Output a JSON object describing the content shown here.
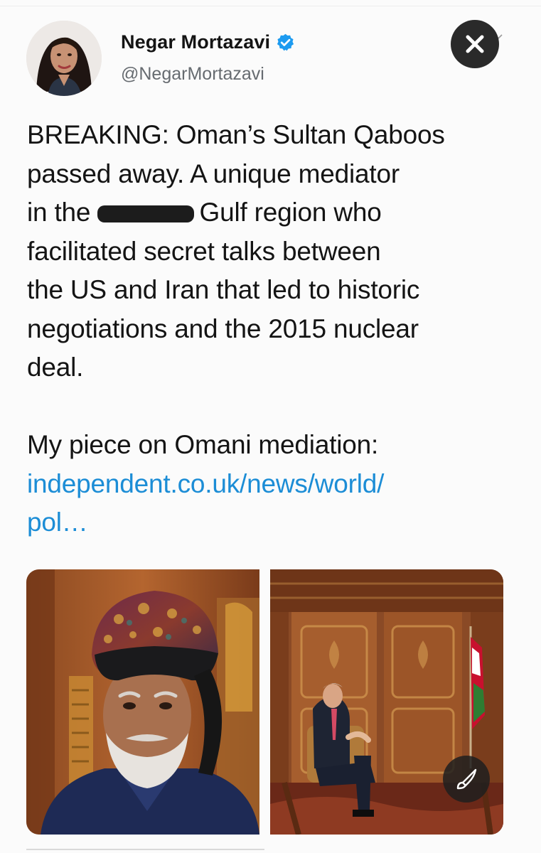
{
  "tweet": {
    "author": {
      "display_name": "Negar Mortazavi",
      "handle": "@NegarMortazavi",
      "verified": true,
      "avatar_icon": "profile-photo"
    },
    "text_lines_1": [
      "BREAKING: Oman’s Sultan Qaboos",
      "passed away. A unique mediator"
    ],
    "line3_prefix": "in the ",
    "line3_suffix": " Gulf region who",
    "text_lines_2": [
      "facilitated secret talks between",
      "the US and Iran that led to historic",
      "negotiations and the 2015 nuclear",
      "deal."
    ],
    "piece_intro": "My piece on Omani mediation:",
    "link_lines": [
      "independent.co.uk/news/world/",
      "pol…"
    ],
    "media": [
      {
        "name": "photo-sultan-qaboos"
      },
      {
        "name": "photo-john-kerry-palace-meeting"
      }
    ]
  },
  "controls": {
    "close_icon": "close-icon",
    "edit_icon": "paintbrush-icon",
    "menu_icon": "chevron-down-icon"
  },
  "colors": {
    "link": "#1c8dd6",
    "verified": "#1d9bf0",
    "text": "#141414",
    "secondary": "#666b70",
    "close_button": "#2a2a2a"
  }
}
